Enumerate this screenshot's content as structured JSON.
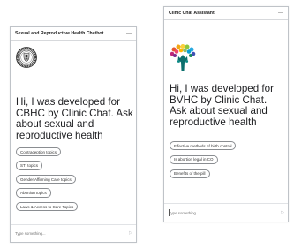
{
  "widgets": [
    {
      "header_title": "Sexual and Reproductive Health Chatbot",
      "minimize_symbol": "—",
      "logo_icon": "circular-seal-logo",
      "greeting": "Hi, I was developed for CBHC by Clinic Chat. Ask about sexual and reproductive health",
      "chips": [
        "Contraception topics",
        "STI topics",
        "Gender Affirming Care topics",
        "Abortion topics",
        "Laws & Access to Care Topics"
      ],
      "input_placeholder": "Type something...",
      "send_icon": "send-arrow-icon"
    },
    {
      "header_title": "Clinic Chat Assistant",
      "minimize_symbol": "—",
      "logo_icon": "colorful-tree-hands-logo",
      "greeting": "Hi, I was developed for BVHC by Clinic Chat. Ask about sexual and reproductive health",
      "chips": [
        "Effective methods of birth control",
        "Is abortion legal in CO",
        "Benefits of the pill"
      ],
      "input_placeholder": "Type something...",
      "send_icon": "send-arrow-icon"
    }
  ]
}
